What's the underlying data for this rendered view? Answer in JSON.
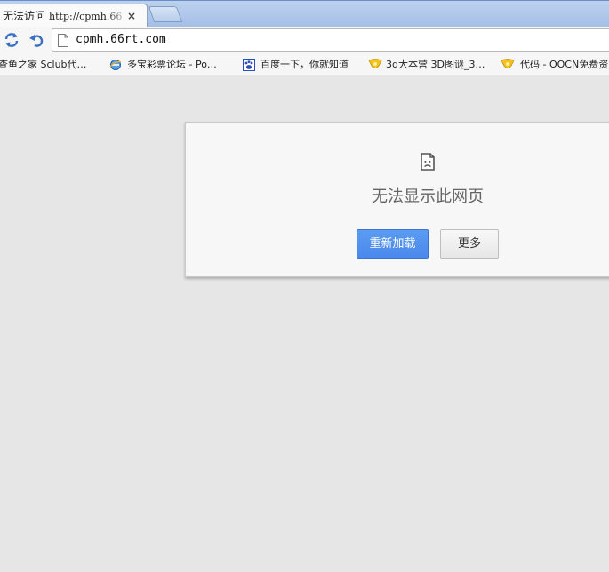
{
  "tab": {
    "title_cn": "无法访问",
    "title_url": "http://cpmh.66",
    "close": "×"
  },
  "omnibox": {
    "url": "cpmh.66rt.com"
  },
  "bookmarks": [
    {
      "label": "查鱼之家 Sclub代…",
      "icon": "none"
    },
    {
      "label": "多宝彩票论坛 - Po…",
      "icon": "ie-globe-icon"
    },
    {
      "label": "百度一下，你就知道",
      "icon": "baidu-paw-icon"
    },
    {
      "label": "3d大本营 3D图谜_3…",
      "icon": "yellow-badge-icon"
    },
    {
      "label": "代码 - OOCN免费资",
      "icon": "yellow-badge-icon"
    }
  ],
  "error": {
    "title": "无法显示此网页",
    "reload_label": "重新加载",
    "more_label": "更多"
  },
  "colors": {
    "reload_button": "#4a87ec",
    "page_background": "#e6e6e6",
    "tab_strip": "#a4bfe6"
  }
}
